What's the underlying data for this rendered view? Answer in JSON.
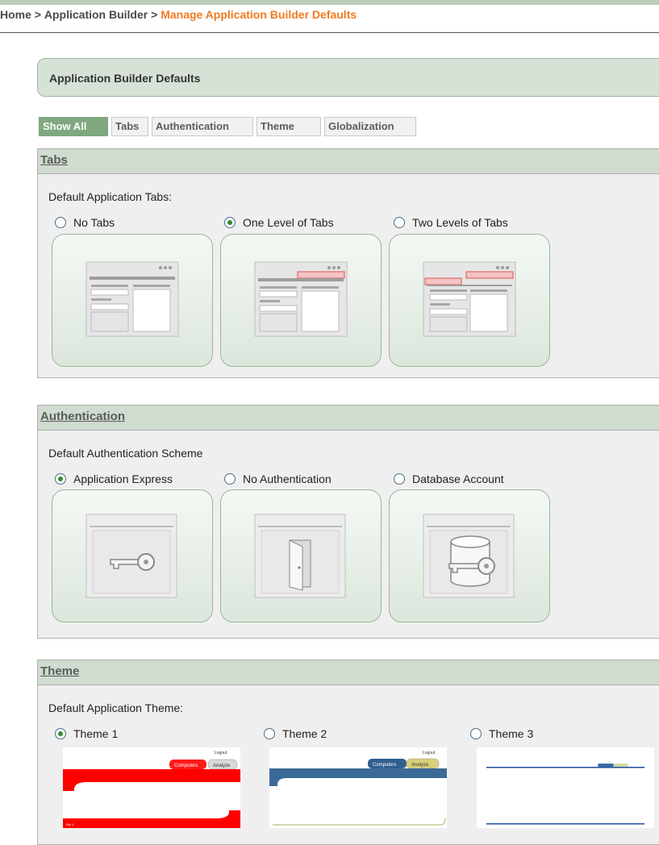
{
  "breadcrumb": {
    "home": "Home",
    "sep1": " > ",
    "app_builder": "Application Builder",
    "sep2": " > ",
    "current": "Manage Application Builder Defaults"
  },
  "region": {
    "title": "Application Builder Defaults"
  },
  "filters": [
    "Show All",
    "Tabs",
    "Authentication",
    "Theme",
    "Globalization"
  ],
  "tabs_section": {
    "title": "Tabs",
    "label": "Default Application Tabs:",
    "options": [
      {
        "label": "No Tabs",
        "checked": false
      },
      {
        "label": "One Level of Tabs",
        "checked": true
      },
      {
        "label": "Two Levels of Tabs",
        "checked": false
      }
    ]
  },
  "auth_section": {
    "title": "Authentication",
    "label": "Default Authentication Scheme",
    "options": [
      {
        "label": "Application Express",
        "checked": true,
        "icon": "key-icon"
      },
      {
        "label": "No Authentication",
        "checked": false,
        "icon": "door-icon"
      },
      {
        "label": "Database Account",
        "checked": false,
        "icon": "database-key-icon"
      }
    ]
  },
  "theme_section": {
    "title": "Theme",
    "label": "Default Application Theme:",
    "options": [
      {
        "label": "Theme 1",
        "checked": true,
        "tab1": "Computers",
        "tab2": "Analyze",
        "top_link": "Logout",
        "footer": "Rel 1",
        "accent": "#ff0000"
      },
      {
        "label": "Theme 2",
        "checked": false,
        "tab1": "Computers",
        "tab2": "Analyze",
        "top_link": "Logout",
        "accent": "#2f5f8f"
      },
      {
        "label": "Theme 3",
        "checked": false,
        "accent": "#2f5f8f"
      }
    ]
  },
  "colors": {
    "accent": "#f07a1f",
    "section_header": "#cfdccf",
    "active_filter": "#7fa87f"
  }
}
